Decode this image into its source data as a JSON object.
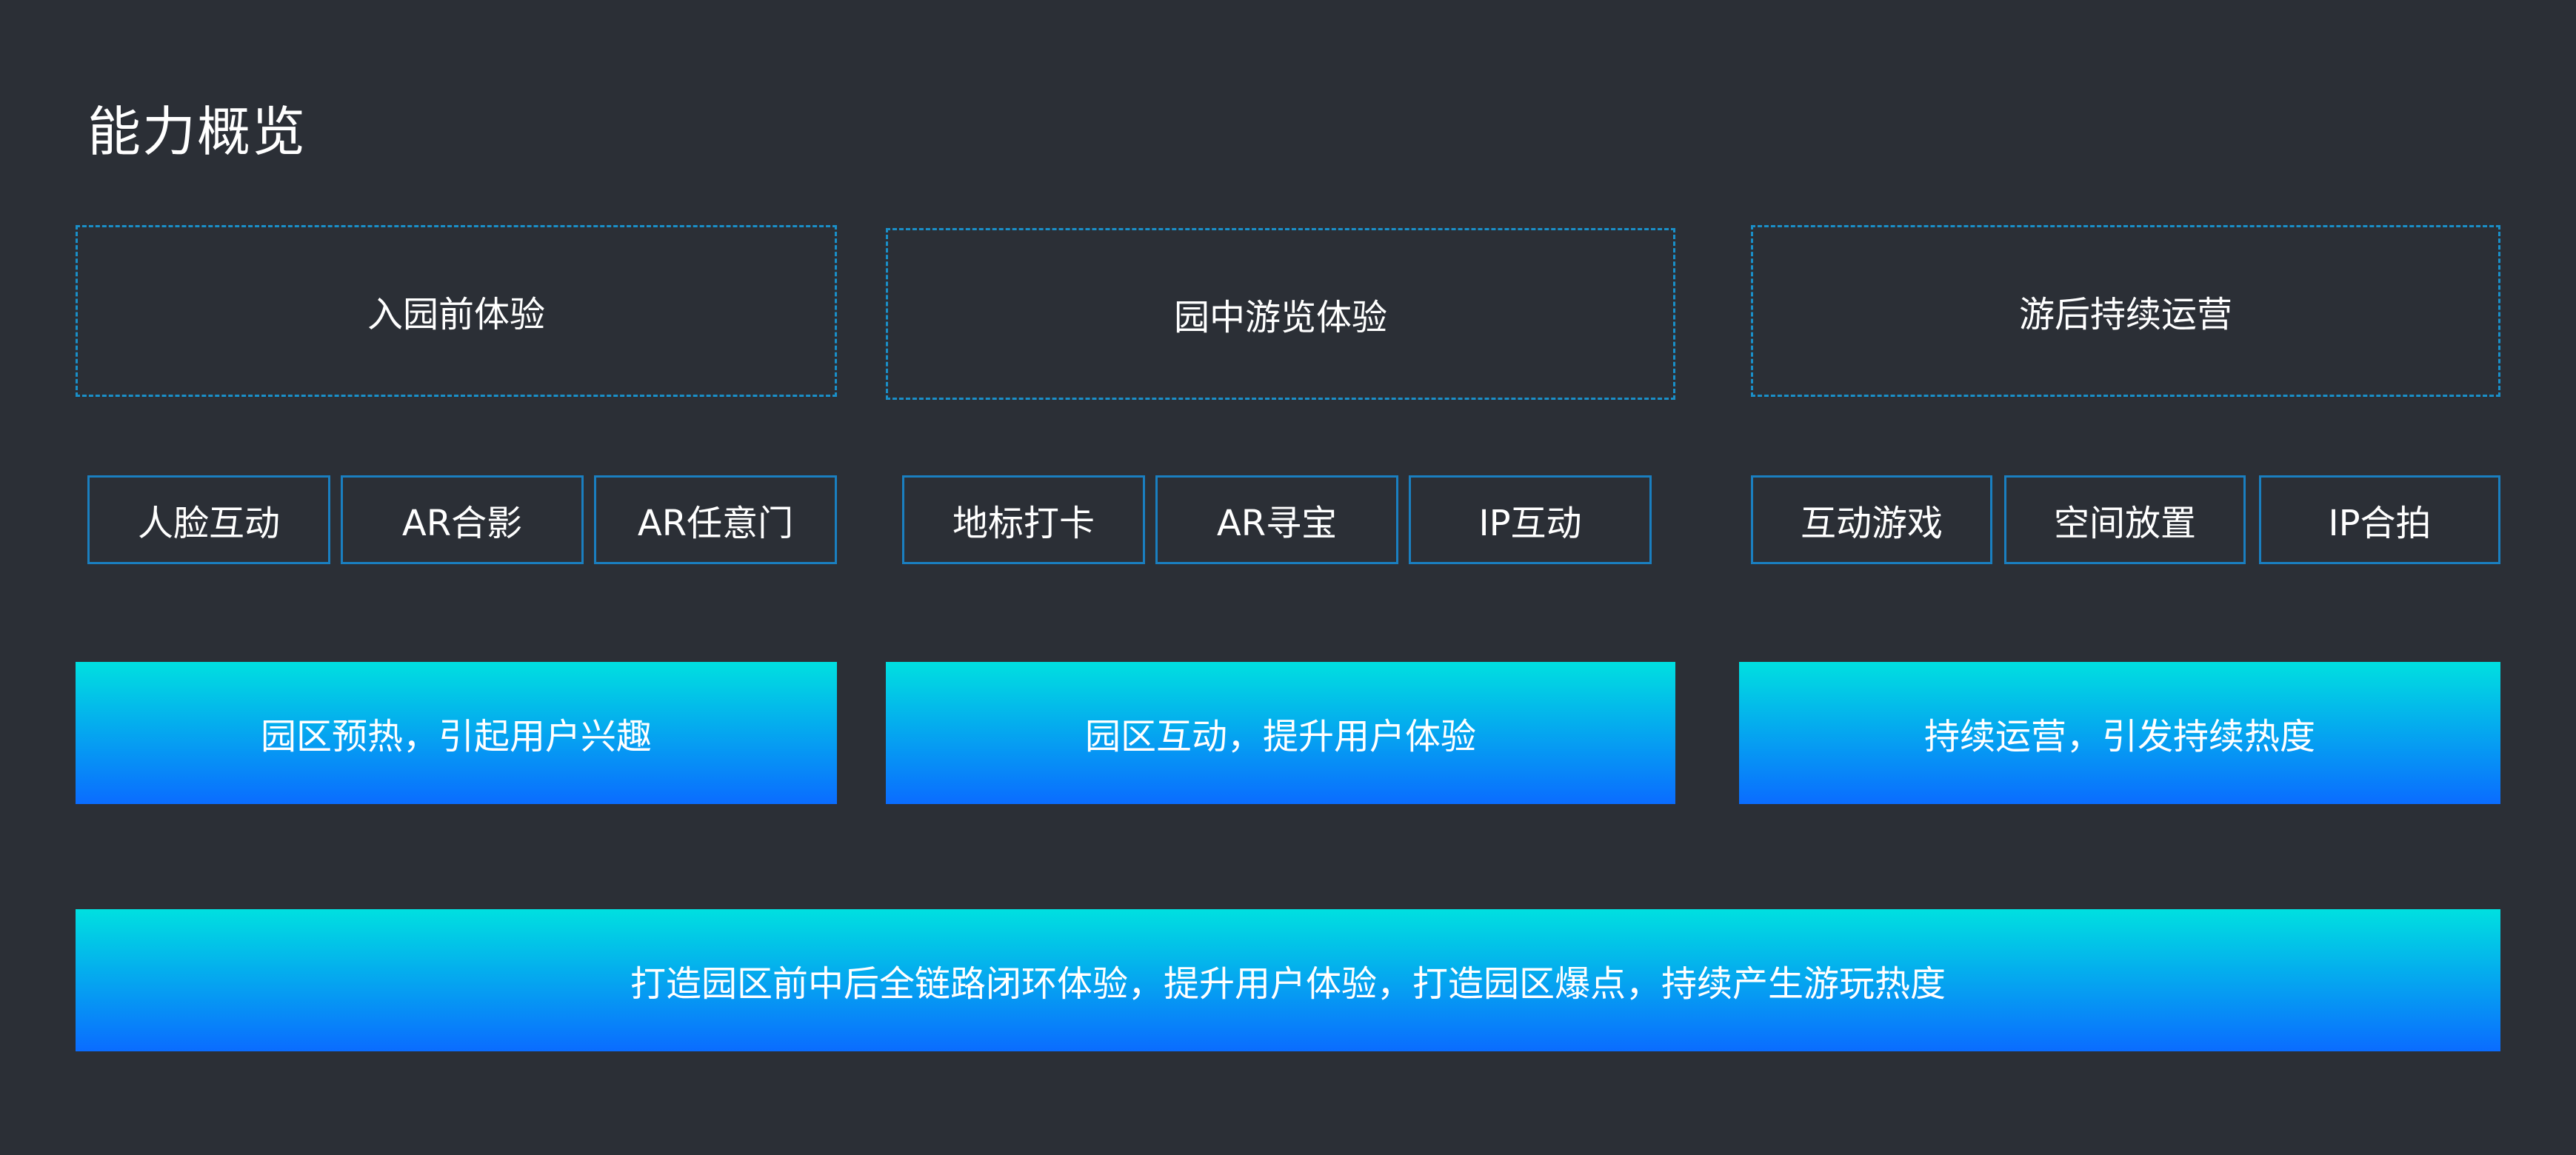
{
  "page": {
    "title": "能力概览"
  },
  "columns": [
    {
      "stage": "入园前体验",
      "features": [
        "人脸互动",
        "AR合影",
        "AR任意门"
      ],
      "goal": "园区预热，引起用户兴趣"
    },
    {
      "stage": "园中游览体验",
      "features": [
        "地标打卡",
        "AR寻宝",
        "IP互动"
      ],
      "goal": "园区互动，提升用户体验"
    },
    {
      "stage": "游后持续运营",
      "features": [
        "互动游戏",
        "空间放置",
        "IP合拍"
      ],
      "goal": "持续运营，引发持续热度"
    }
  ],
  "summary": "打造园区前中后全链路闭环体验，提升用户体验，打造园区爆点，持续产生游玩热度",
  "colors": {
    "background": "#2b2f36",
    "dashed_border": "#1a8fc8",
    "feature_border": "#1a7fc0",
    "gradient_top": "#00e0e0",
    "gradient_bottom": "#0a6cff"
  }
}
